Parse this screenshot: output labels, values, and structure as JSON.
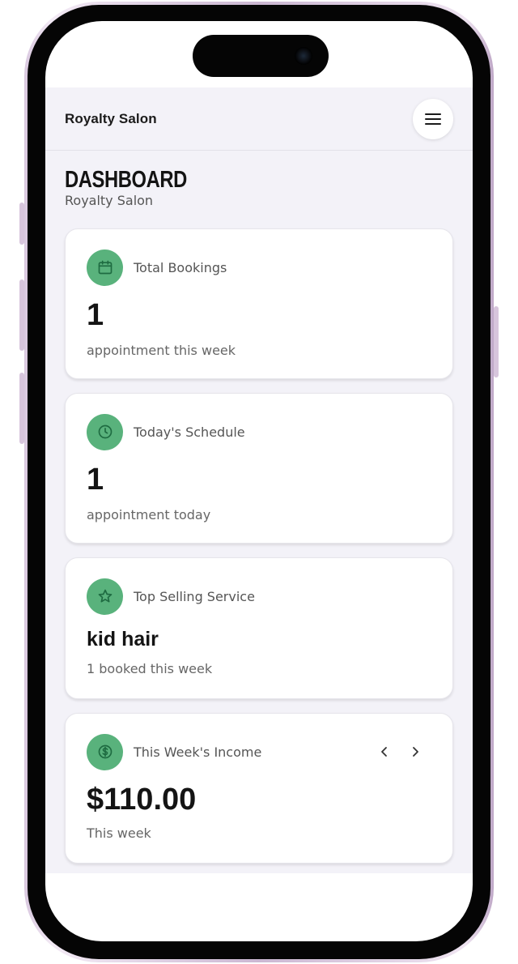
{
  "header": {
    "brand": "Royalty Salon",
    "menu_icon": "menu-icon"
  },
  "page": {
    "title": "DASHBOARD",
    "subtitle": "Royalty Salon"
  },
  "cards": [
    {
      "icon": "calendar-icon",
      "label": "Total Bookings",
      "value": "1",
      "desc": "appointment this week"
    },
    {
      "icon": "clock-icon",
      "label": "Today's Schedule",
      "value": "1",
      "desc": "appointment today"
    },
    {
      "icon": "star-icon",
      "label": "Top Selling Service",
      "value": "kid hair",
      "desc": "1 booked this week"
    },
    {
      "icon": "dollar-icon",
      "label": "This Week's Income",
      "value": "$110.00",
      "desc": "This week"
    }
  ],
  "colors": {
    "accent": "#59b27c",
    "background": "#f3f2f8",
    "card": "#ffffff",
    "text": "#141414"
  }
}
